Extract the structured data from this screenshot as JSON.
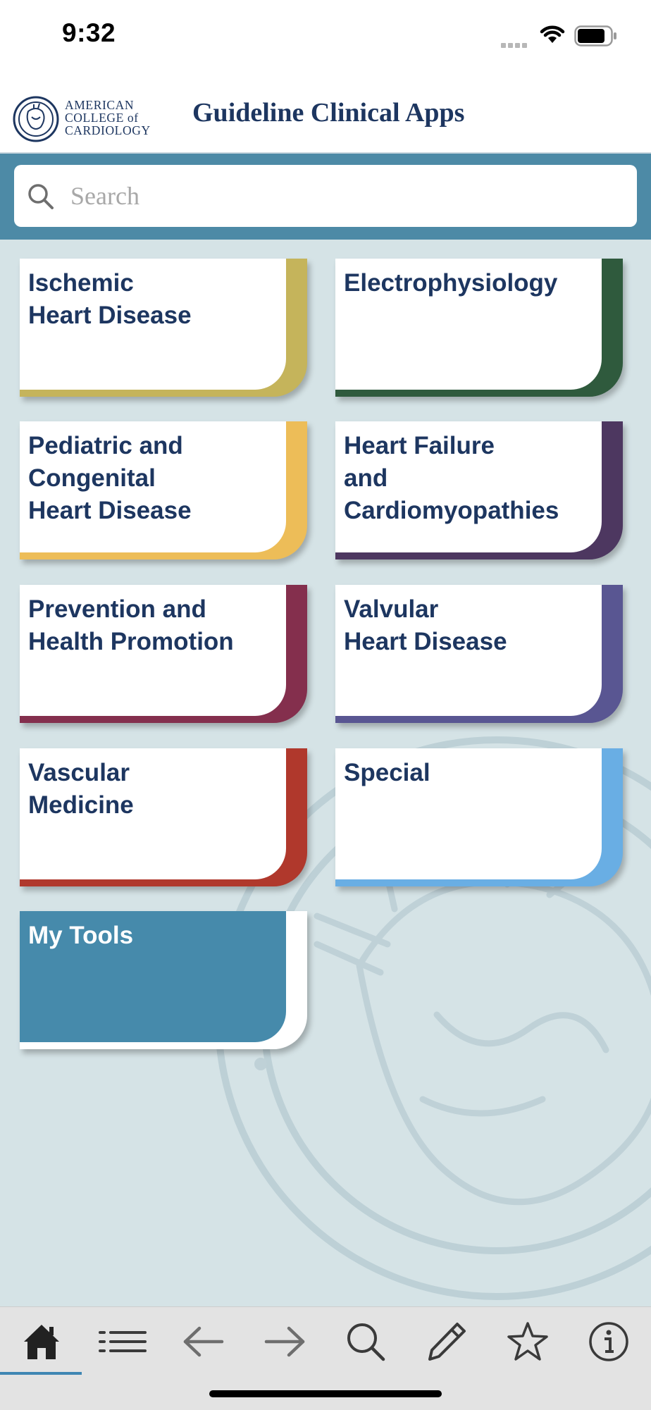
{
  "status_bar": {
    "time": "9:32"
  },
  "header": {
    "logo_lines": [
      "AMERICAN",
      "COLLEGE of",
      "CARDIOLOGY"
    ],
    "title": "Guideline Clinical Apps"
  },
  "search": {
    "placeholder": "Search",
    "value": ""
  },
  "tiles": [
    {
      "label": "Ischemic\nHeart Disease",
      "accent": "#c5b45b"
    },
    {
      "label": "Electrophysiology",
      "accent": "#2f5a3d"
    },
    {
      "label": "Pediatric and\nCongenital\nHeart Disease",
      "accent": "#edbd58"
    },
    {
      "label": "Heart Failure\nand\nCardiomyopathies",
      "accent": "#4d3760"
    },
    {
      "label": "Prevention and\nHealth Promotion",
      "accent": "#842f4d"
    },
    {
      "label": "Valvular\nHeart Disease",
      "accent": "#595692"
    },
    {
      "label": "Vascular\nMedicine",
      "accent": "#b0382c"
    },
    {
      "label": "Special",
      "accent": "#69aee4"
    },
    {
      "label": "My Tools",
      "accent": "#ffffff",
      "fill": "#468aab"
    }
  ],
  "bottom_nav": {
    "items": [
      "home-icon",
      "list-icon",
      "back-arrow-icon",
      "forward-arrow-icon",
      "search-icon",
      "pencil-icon",
      "star-icon",
      "info-icon"
    ],
    "active": "home-icon"
  },
  "colors": {
    "brand_navy": "#1d3660",
    "search_band": "#4d8aa6",
    "background": "#d5e3e6"
  }
}
